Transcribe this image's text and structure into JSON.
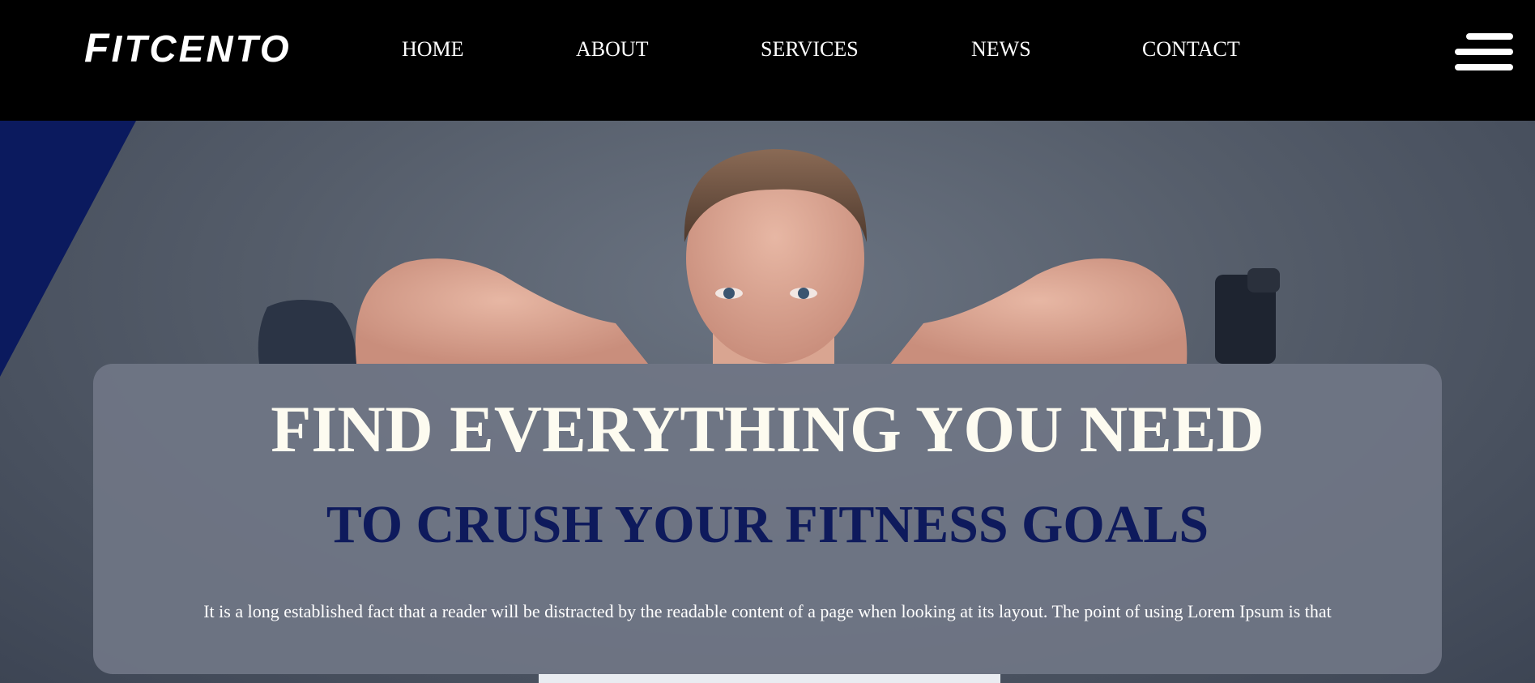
{
  "header": {
    "logo_first": "F",
    "logo_rest": "ITCENTO"
  },
  "nav": {
    "items": [
      {
        "label": "HOME"
      },
      {
        "label": "ABOUT"
      },
      {
        "label": "SERVICES"
      },
      {
        "label": "NEWS"
      },
      {
        "label": "CONTACT"
      }
    ]
  },
  "menu": {
    "icon": "hamburger-menu-icon"
  },
  "hero": {
    "headline": "FIND EVERYTHING YOU NEED",
    "subheadline": "TO CRUSH YOUR FITNESS GOALS",
    "body": "It is a long established fact that a reader will be distracted by the readable content of a page when looking at its layout. The point of using Lorem Ipsum is that"
  },
  "colors": {
    "header_bg": "#000000",
    "accent_navy": "#0e1a5c",
    "headline": "#fdfbf0",
    "card_bg": "#707685"
  }
}
